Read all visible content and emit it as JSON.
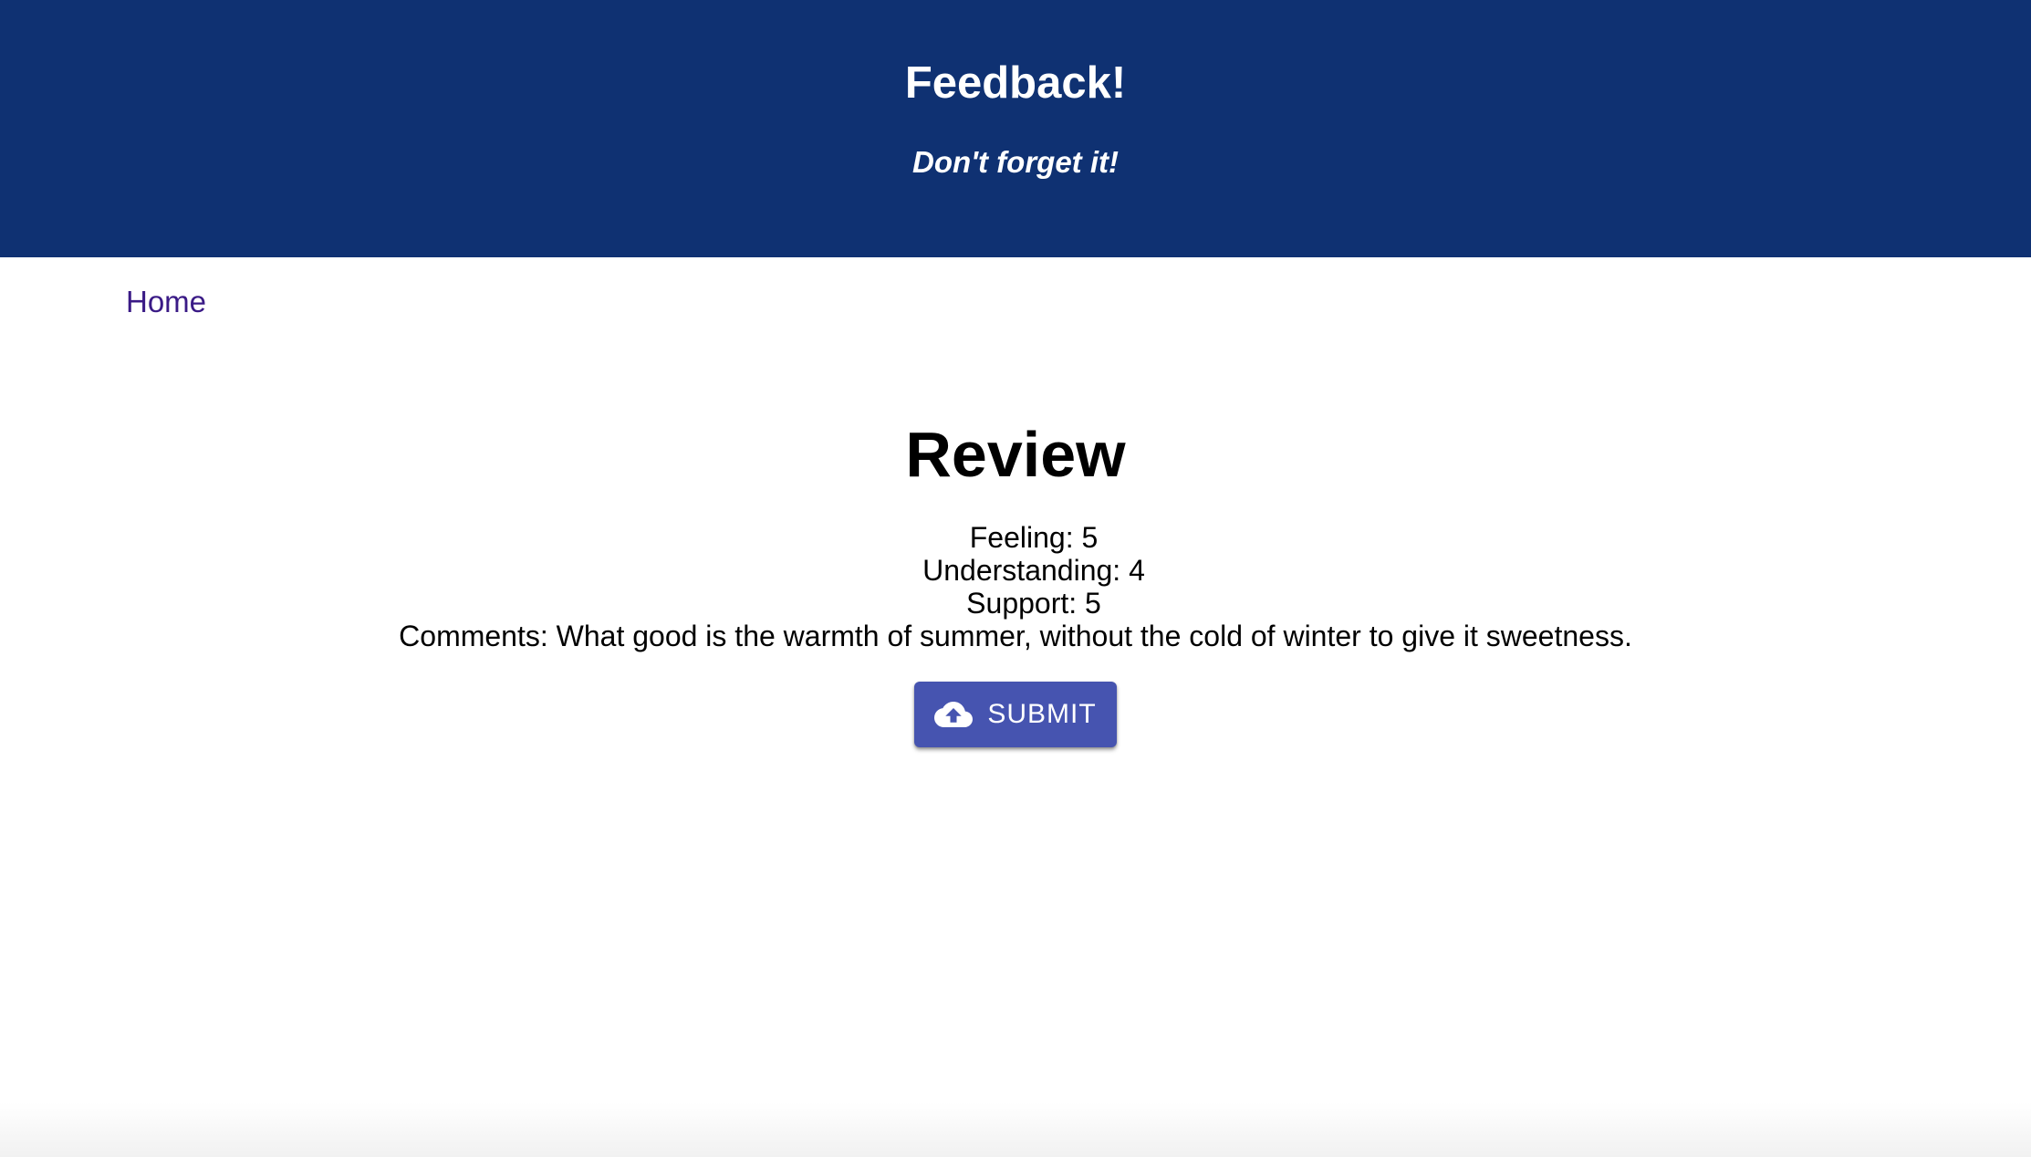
{
  "header": {
    "title": "Feedback!",
    "subtitle": "Don't forget it!",
    "background_color": "#0f3172"
  },
  "nav": {
    "home_label": "Home",
    "link_color": "#3a1a86"
  },
  "review": {
    "title": "Review",
    "lines": [
      "Feeling: 5",
      "Understanding: 4",
      "Support: 5",
      "Comments: What good is the warmth of summer, without the cold of winter to give it sweetness."
    ]
  },
  "submit": {
    "label": "SUBMIT",
    "icon": "cloud-upload-icon",
    "color": "#4654b0"
  }
}
